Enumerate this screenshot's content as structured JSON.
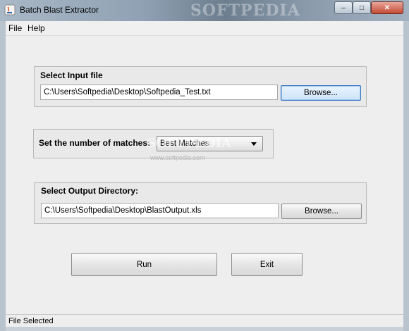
{
  "window": {
    "title": "Batch Blast Extractor",
    "watermark": "SOFTPEDIA",
    "controls": {
      "minimize": "–",
      "maximize": "□",
      "close": "✕"
    }
  },
  "menu": [
    "File",
    "Help"
  ],
  "input_panel": {
    "title": "Select Input file",
    "path": "C:\\Users\\Softpedia\\Desktop\\Softpedia_Test.txt",
    "browse_label": "Browse..."
  },
  "matches_panel": {
    "title": "Set the number of matches:",
    "selected": "Best Matches"
  },
  "output_panel": {
    "title": "Select Output Directory:",
    "path": "C:\\Users\\Softpedia\\Desktop\\BlastOutput.xls",
    "browse_label": "Browse..."
  },
  "actions": {
    "run": "Run",
    "exit": "Exit"
  },
  "status": "File Selected",
  "overlay": {
    "mark": "SOFTPEDIA",
    "url": "www.softpedia.com"
  }
}
